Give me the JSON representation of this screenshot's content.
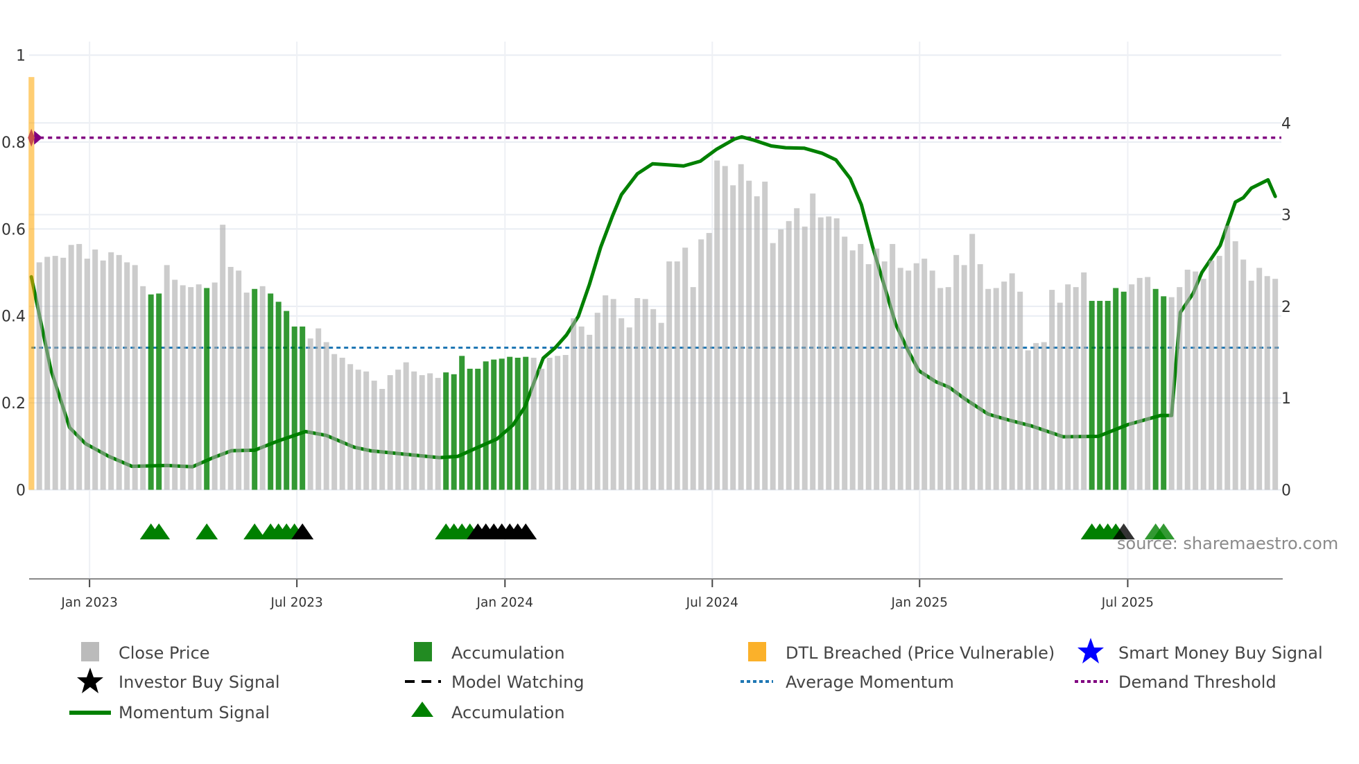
{
  "chart_data": {
    "type": "bar",
    "title": "",
    "x_unit": "week index",
    "x_ticks": [
      {
        "label": "Jan 2023",
        "at": 7.3
      },
      {
        "label": "Jul 2023",
        "at": 33.3
      },
      {
        "label": "Jan 2024",
        "at": 59.4
      },
      {
        "label": "Jul 2024",
        "at": 85.4
      },
      {
        "label": "Jan 2025",
        "at": 111.4
      },
      {
        "label": "Jul 2025",
        "at": 137.5
      }
    ],
    "x_range": [
      -1,
      158
    ],
    "left_axis": {
      "range": [
        0,
        1
      ],
      "ticks": [
        "0",
        "0.2",
        "0.4",
        "0.6",
        "0.8",
        "1"
      ],
      "tick_values": [
        0,
        0.2,
        0.4,
        0.6,
        0.8,
        1
      ]
    },
    "right_axis": {
      "range": [
        0,
        4.74
      ],
      "ticks": [
        "0",
        "1",
        "2",
        "3",
        "4"
      ],
      "tick_values": [
        0,
        1,
        2,
        3,
        4
      ]
    },
    "grid": true,
    "close_price": [
      2.48,
      2.54,
      2.55,
      2.53,
      2.67,
      2.68,
      2.52,
      2.62,
      2.5,
      2.59,
      2.56,
      2.48,
      2.45,
      2.22,
      2.13,
      2.14,
      2.45,
      2.29,
      2.23,
      2.21,
      2.24,
      2.2,
      2.26,
      2.89,
      2.43,
      2.39,
      2.15,
      2.19,
      2.22,
      2.14,
      2.05,
      1.95,
      1.78,
      1.78,
      1.65,
      1.76,
      1.61,
      1.48,
      1.44,
      1.37,
      1.31,
      1.29,
      1.19,
      1.1,
      1.25,
      1.31,
      1.39,
      1.29,
      1.25,
      1.27,
      1.22,
      1.28,
      1.26,
      1.46,
      1.32,
      1.32,
      1.4,
      1.42,
      1.43,
      1.45,
      1.44,
      1.45,
      1.44,
      1.32,
      1.44,
      1.46,
      1.47,
      1.87,
      1.78,
      1.69,
      1.93,
      2.12,
      2.08,
      1.87,
      1.77,
      2.09,
      2.08,
      1.97,
      1.82,
      2.49,
      2.49,
      2.64,
      2.21,
      2.73,
      2.8,
      3.59,
      3.53,
      3.32,
      3.55,
      3.37,
      3.2,
      3.36,
      2.69,
      2.84,
      2.93,
      3.07,
      2.87,
      3.23,
      2.97,
      2.98,
      2.96,
      2.76,
      2.61,
      2.68,
      2.46,
      2.63,
      2.49,
      2.68,
      2.42,
      2.39,
      2.47,
      2.52,
      2.39,
      2.2,
      2.21,
      2.56,
      2.45,
      2.79,
      2.46,
      2.19,
      2.2,
      2.27,
      2.36,
      2.16,
      1.52,
      1.6,
      1.61,
      2.18,
      2.04,
      2.24,
      2.21,
      2.37,
      2.06,
      2.06,
      2.06,
      2.2,
      2.16,
      2.24,
      2.31,
      2.32,
      2.19,
      2.11,
      2.1,
      2.21,
      2.4,
      2.38,
      2.3,
      2.5,
      2.55,
      2.88,
      2.71,
      2.51,
      2.28,
      2.42,
      2.33,
      2.3
    ],
    "accumulation_weeks": [
      15,
      16,
      22,
      28,
      30,
      31,
      32,
      33,
      34,
      52,
      53,
      54,
      55,
      56,
      57,
      58,
      59,
      60,
      61,
      62,
      133,
      134,
      135,
      136,
      137,
      141,
      142
    ],
    "dtl_breached": {
      "week": 0,
      "value": 4.5
    },
    "momentum_signal": [
      [
        0,
        0.49
      ],
      [
        2.45,
        0.276
      ],
      [
        4.8,
        0.143
      ],
      [
        6.8,
        0.106
      ],
      [
        9.7,
        0.077
      ],
      [
        12.6,
        0.054
      ],
      [
        17,
        0.056
      ],
      [
        20.2,
        0.053
      ],
      [
        22.8,
        0.074
      ],
      [
        25.1,
        0.09
      ],
      [
        28,
        0.091
      ],
      [
        30.9,
        0.112
      ],
      [
        34.4,
        0.134
      ],
      [
        37,
        0.125
      ],
      [
        40.5,
        0.098
      ],
      [
        42.5,
        0.09
      ],
      [
        46.8,
        0.082
      ],
      [
        51.2,
        0.074
      ],
      [
        53.5,
        0.077
      ],
      [
        55.8,
        0.096
      ],
      [
        58.4,
        0.117
      ],
      [
        60.4,
        0.149
      ],
      [
        61.9,
        0.191
      ],
      [
        63,
        0.245
      ],
      [
        64.2,
        0.303
      ],
      [
        65.7,
        0.327
      ],
      [
        67.1,
        0.356
      ],
      [
        68.6,
        0.399
      ],
      [
        70,
        0.473
      ],
      [
        71.4,
        0.558
      ],
      [
        72.9,
        0.631
      ],
      [
        74,
        0.679
      ],
      [
        76,
        0.727
      ],
      [
        77.9,
        0.75
      ],
      [
        79.5,
        0.748
      ],
      [
        81.8,
        0.745
      ],
      [
        83.9,
        0.756
      ],
      [
        85.9,
        0.783
      ],
      [
        88.2,
        0.807
      ],
      [
        89.1,
        0.812
      ],
      [
        90.5,
        0.805
      ],
      [
        92.8,
        0.791
      ],
      [
        94.6,
        0.787
      ],
      [
        96.9,
        0.786
      ],
      [
        99.2,
        0.774
      ],
      [
        100.9,
        0.759
      ],
      [
        102.7,
        0.716
      ],
      [
        104.1,
        0.656
      ],
      [
        105.5,
        0.559
      ],
      [
        107,
        0.468
      ],
      [
        108.4,
        0.381
      ],
      [
        109.9,
        0.322
      ],
      [
        111.3,
        0.274
      ],
      [
        113.4,
        0.249
      ],
      [
        115.1,
        0.236
      ],
      [
        117.1,
        0.209
      ],
      [
        120,
        0.174
      ],
      [
        122.5,
        0.161
      ],
      [
        125.4,
        0.147
      ],
      [
        129.4,
        0.122
      ],
      [
        133.8,
        0.123
      ],
      [
        137.5,
        0.15
      ],
      [
        141.6,
        0.171
      ],
      [
        143,
        0.171
      ],
      [
        144.1,
        0.408
      ],
      [
        145.7,
        0.452
      ],
      [
        146.8,
        0.5
      ],
      [
        149.1,
        0.562
      ],
      [
        151,
        0.662
      ],
      [
        152,
        0.672
      ],
      [
        153,
        0.694
      ],
      [
        155.1,
        0.713
      ],
      [
        156,
        0.675
      ]
    ],
    "average_momentum": 0.327,
    "demand_threshold": 0.81,
    "accumulation_markers": [
      15,
      16,
      22,
      28,
      30,
      31,
      32,
      33,
      52,
      53,
      54,
      55,
      133,
      134,
      135,
      136,
      141,
      142
    ],
    "dark_markers": [
      34,
      56,
      57,
      58,
      59,
      60,
      61,
      62,
      137
    ],
    "colors": {
      "close_price": "#aaaaaa",
      "accumulation": "#008000",
      "dtl": "#ffa500",
      "momentum": "#008000",
      "average_momentum": "#1f77b4",
      "demand_threshold": "#800080",
      "smart_money": "#0000ff",
      "investor": "#000000"
    },
    "legend": [
      {
        "label": "Close Price",
        "symbol": "rect-gray"
      },
      {
        "label": "Accumulation",
        "symbol": "rect-green"
      },
      {
        "label": "DTL Breached (Price Vulnerable)",
        "symbol": "rect-orange"
      },
      {
        "label": "Smart Money Buy Signal",
        "symbol": "star-blue"
      },
      {
        "label": "Investor Buy Signal",
        "symbol": "star-black"
      },
      {
        "label": "Model Watching",
        "symbol": "dash-black"
      },
      {
        "label": "Average Momentum",
        "symbol": "dot-blue"
      },
      {
        "label": "Demand Threshold",
        "symbol": "dot-purple"
      },
      {
        "label": "Momentum Signal",
        "symbol": "line-green"
      },
      {
        "label": "Accumulation",
        "symbol": "triangle-green"
      }
    ],
    "legend_placement": "bottom",
    "annotation": "source: sharemaestro.com"
  }
}
